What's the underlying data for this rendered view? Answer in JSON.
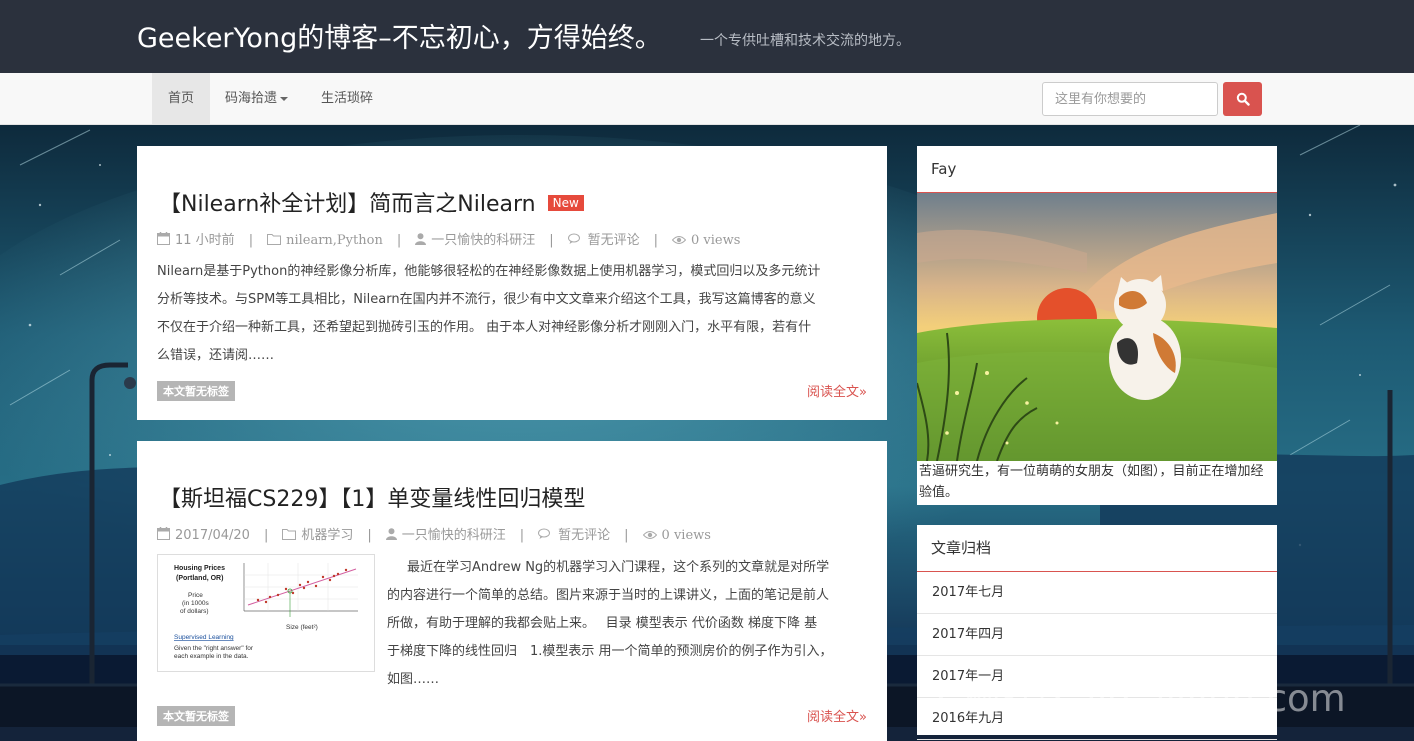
{
  "header": {
    "title": "GeekerYong的博客–不忘初心，方得始终。",
    "subtitle": "一个专供吐槽和技术交流的地方。"
  },
  "nav": {
    "items": [
      {
        "label": "首页",
        "active": true
      },
      {
        "label": "码海拾遗",
        "dropdown": true
      },
      {
        "label": "生活琐碎"
      }
    ],
    "search_placeholder": "这里有你想要的",
    "search_icon": "search-icon"
  },
  "posts": [
    {
      "title": "【Nilearn补全计划】简而言之Nilearn",
      "badge": "New",
      "date": "11 小时前",
      "categories": "nilearn,Python",
      "author": "一只愉快的科研汪",
      "comments": "暂无评论",
      "views": "0 views",
      "excerpt_lines": [
        "Nilearn是基于Python的神经影像分析库，他能够很轻松的在神经影像数据上使用机器学习，模式回归以及多元统计",
        "分析等技术。与SPM等工具相比，Nilearn在国内并不流行，很少有中文文章来介绍这个工具，我写这篇博客的意义",
        "不仅在于介绍一种新工具，还希望起到抛砖引玉的作用。 由于本人对神经影像分析才刚刚入门，水平有限，若有什",
        "么错误，还请阅……"
      ],
      "tag": "本文暂无标签",
      "read_more": "阅读全文»"
    },
    {
      "title": "【斯坦福CS229】【1】单变量线性回归模型",
      "date": "2017/04/20",
      "categories": "机器学习",
      "author": "一只愉快的科研汪",
      "comments": "暂无评论",
      "views": "0 views",
      "thumbnail": {
        "heading_1": "Housing Prices",
        "heading_2": "(Portland, OR)",
        "ylabel_1": "Price",
        "ylabel_2": "(in 1000s",
        "ylabel_3": "of dollars)",
        "xlabel": "Size (feet²)",
        "note_1": "Supervised Learning",
        "note_2": "Given the \"right answer\" for",
        "note_3": "each example in the data."
      },
      "excerpt_lines": [
        "最近在学习Andrew Ng的机器学习入门课程，这个系列的文章就是对所学",
        "的内容进行一个简单的总结。图片来源于当时的上课讲义，上面的笔记是前人",
        "所做，有助于理解的我都会贴上来。　 目录 模型表示 代价函数 梯度下降 基",
        "于梯度下降的线性回归　1.模型表示 用一个简单的预测房价的例子作为引入，",
        "如图……"
      ],
      "tag": "本文暂无标签",
      "read_more": "阅读全文»"
    }
  ],
  "sidebar": {
    "profile": {
      "name": "Fay",
      "description": "苦逼研究生，有一位萌萌的女朋友（如图），目前正在增加经验值。"
    },
    "archive": {
      "title": "文章归档",
      "items": [
        "2017年七月",
        "2017年四月",
        "2017年一月",
        "2016年九月"
      ]
    }
  },
  "watermark": "云栖社区 yq.aliyun.com"
}
